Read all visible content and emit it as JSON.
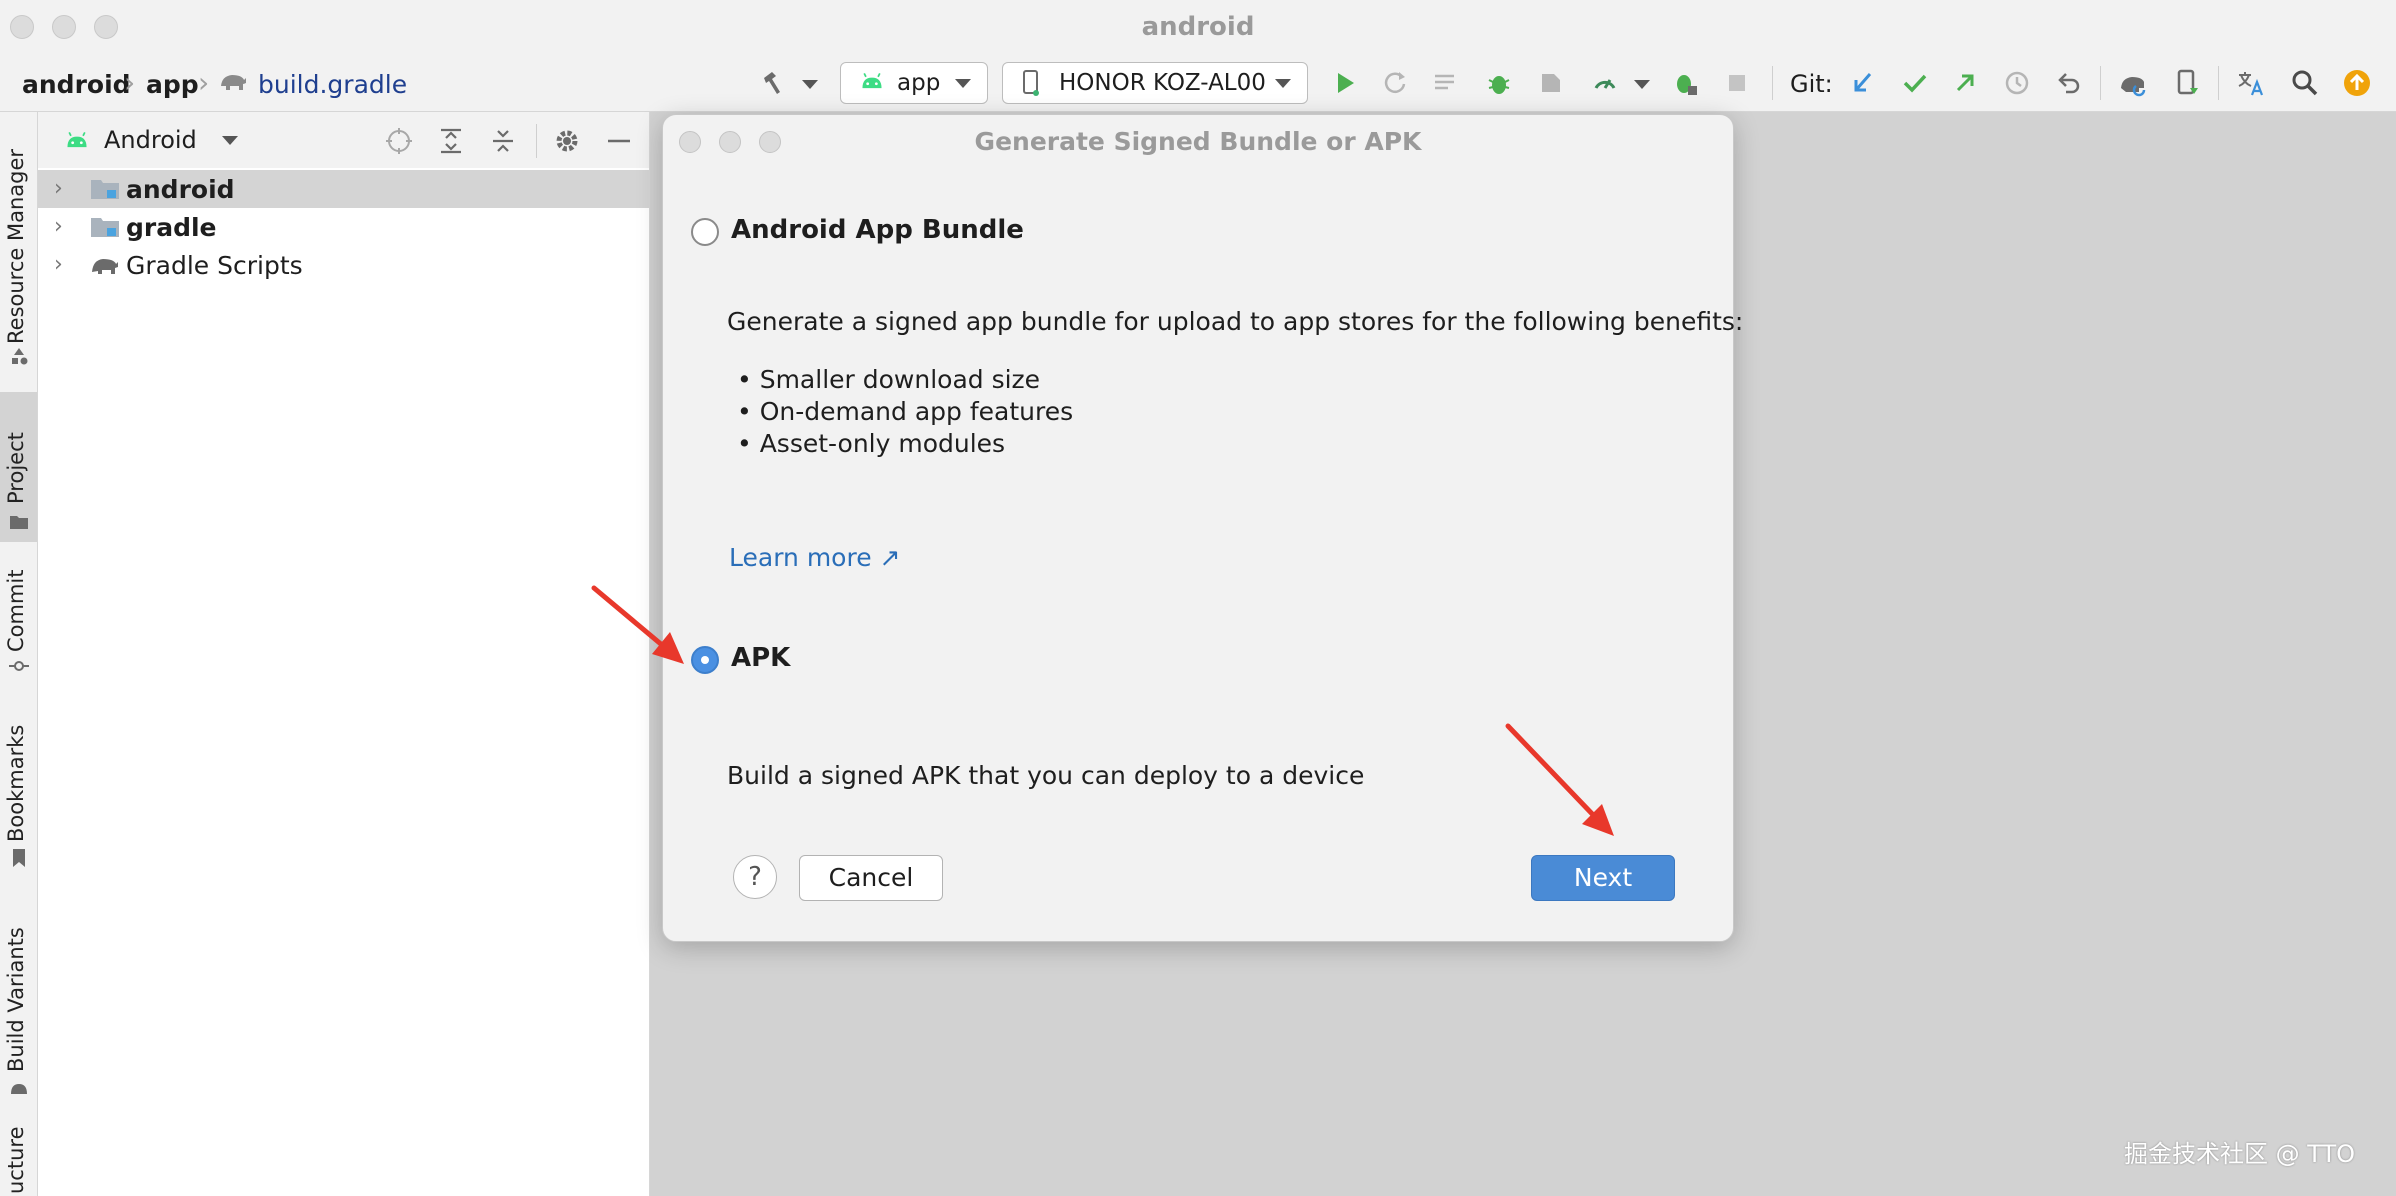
{
  "window": {
    "title": "android"
  },
  "breadcrumb": {
    "project": "android",
    "module": "app",
    "file": "build.gradle"
  },
  "toolbar": {
    "run_config": "app",
    "device": "HONOR KOZ-AL00",
    "git_label": "Git:",
    "icons": [
      "hammer-icon",
      "play-icon",
      "rerun-icon",
      "coverage-icon",
      "debug-icon",
      "profile-icon",
      "attach-icon",
      "stop-icon",
      "git-update-icon",
      "git-commit-icon",
      "git-push-icon",
      "history-icon",
      "rollback-icon",
      "sync-icon",
      "device-manager-icon",
      "translate-icon",
      "search-icon",
      "update-icon"
    ]
  },
  "left_strip": {
    "tabs": [
      "Resource Manager",
      "Project",
      "Commit",
      "Bookmarks",
      "Build Variants",
      "ucture"
    ]
  },
  "project_panel": {
    "view_mode": "Android",
    "tree": [
      {
        "label": "android",
        "bold": true,
        "selected": true
      },
      {
        "label": "gradle",
        "bold": true,
        "selected": false
      },
      {
        "label": "Gradle Scripts",
        "bold": false,
        "selected": false
      }
    ]
  },
  "dialog": {
    "title": "Generate Signed Bundle or APK",
    "option_bundle": {
      "label": "Android App Bundle",
      "selected": false,
      "description": "Generate a signed app bundle for upload to app stores for the following benefits:",
      "benefits": [
        "Smaller download size",
        "On-demand app features",
        "Asset-only modules"
      ],
      "learn_more": "Learn more ↗"
    },
    "option_apk": {
      "label": "APK",
      "selected": true,
      "description": "Build a signed APK that you can deploy to a device"
    },
    "help": "?",
    "cancel": "Cancel",
    "next": "Next"
  },
  "watermark": "掘金技术社区 @ TTO",
  "colors": {
    "accent": "#4a8bd6",
    "arrow": "#e8382b",
    "link": "#2a6eb8"
  }
}
